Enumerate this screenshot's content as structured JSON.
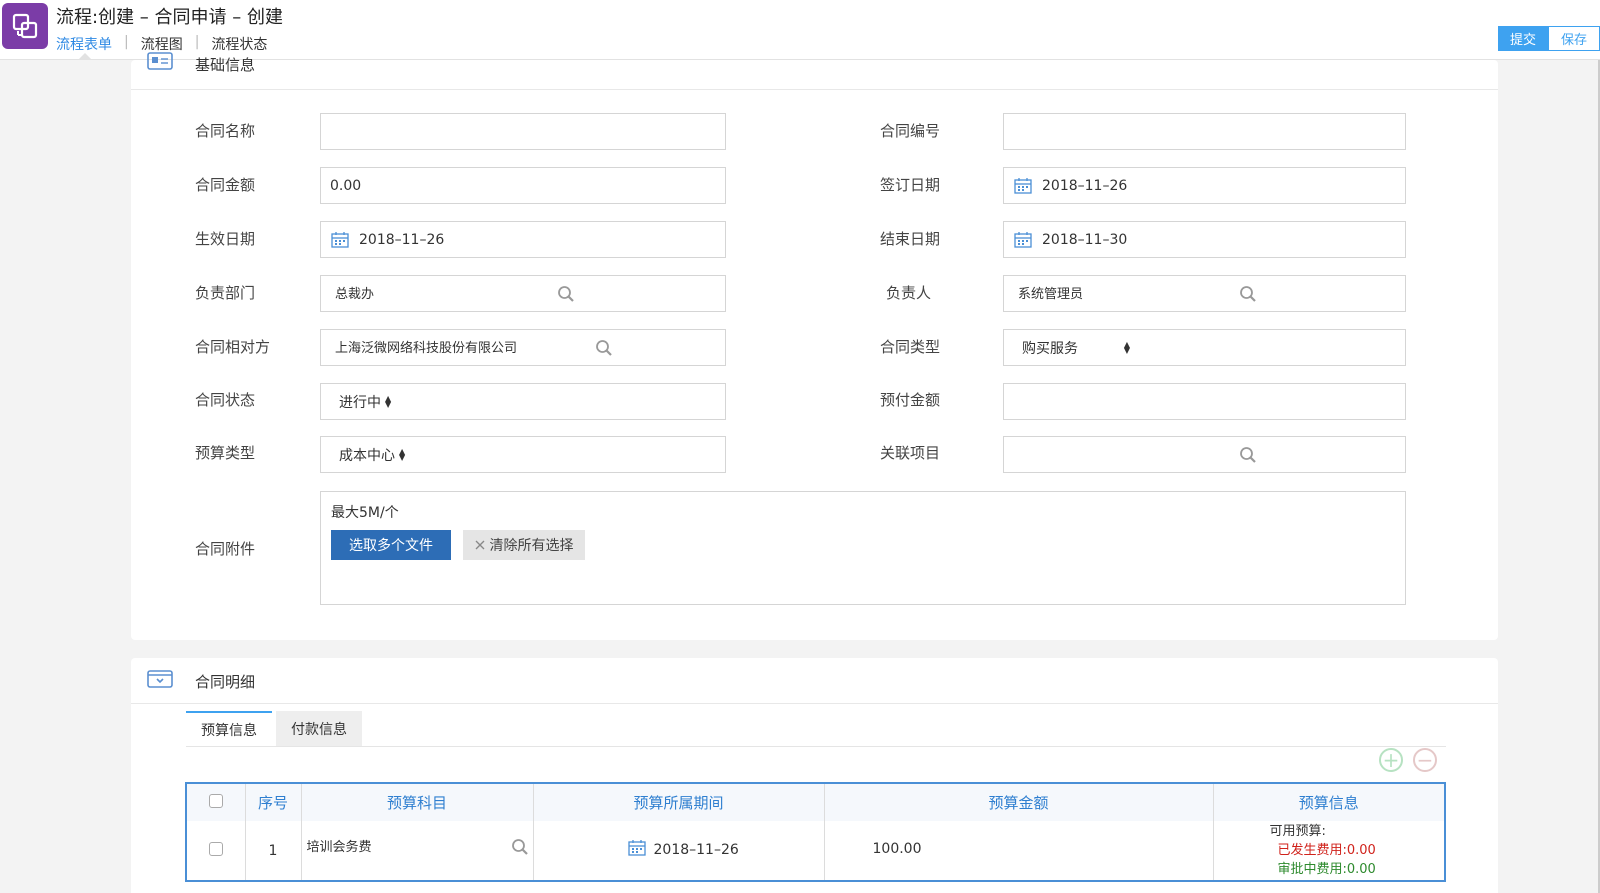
{
  "header": {
    "title": "流程:创建 – 合同申请 – 创建",
    "nav": [
      "流程表单",
      "流程图",
      "流程状态"
    ],
    "nav_sep": "|",
    "submit_label": "提交",
    "save_label": "保存"
  },
  "basic": {
    "section_title": "基础信息",
    "fields": {
      "contract_name": {
        "label": "合同名称",
        "value": ""
      },
      "contract_no": {
        "label": "合同编号",
        "value": ""
      },
      "contract_amount": {
        "label": "合同金额",
        "value": "0.00"
      },
      "sign_date": {
        "label": "签订日期",
        "value": "2018–11–26"
      },
      "effective_date": {
        "label": "生效日期",
        "value": "2018–11–26"
      },
      "end_date": {
        "label": "结束日期",
        "value": "2018–11–30"
      },
      "department": {
        "label": "负责部门",
        "value": "总裁办"
      },
      "owner": {
        "label": "负责人",
        "value": "系统管理员"
      },
      "counterparty": {
        "label": "合同相对方",
        "value": "上海泛微网络科技股份有限公司"
      },
      "contract_type": {
        "label": "合同类型",
        "value": "购买服务"
      },
      "contract_status": {
        "label": "合同状态",
        "value": "进行中"
      },
      "prepaid_amount": {
        "label": "预付金额",
        "value": ""
      },
      "budget_type": {
        "label": "预算类型",
        "value": "成本中心"
      },
      "related_project": {
        "label": "关联项目",
        "value": ""
      }
    },
    "attachment": {
      "label": "合同附件",
      "hint": "最大5M/个",
      "choose_label": "选取多个文件",
      "clear_label": "清除所有选择"
    }
  },
  "detail": {
    "section_title": "合同明细",
    "tabs": [
      "预算信息",
      "付款信息"
    ],
    "add_symbol": "+",
    "remove_symbol": "−",
    "columns": [
      "序号",
      "预算科目",
      "预算所属期间",
      "预算金额",
      "预算信息"
    ],
    "rows": [
      {
        "index": "1",
        "subject": "培训会务费",
        "period": "2018–11–26",
        "amount": "100.00",
        "available": "可用预算:",
        "incurred": "已发生费用:0.00",
        "approving": "审批中费用:0.00"
      }
    ]
  },
  "colors": {
    "accent": "#3ea2f0",
    "app_icon": "#7b3ca7",
    "primary_button": "#2d6db6",
    "table_border": "#4a8fd6",
    "incurred_text": "#d0221b",
    "approving_text": "#2d8a2d"
  },
  "icons": {
    "app": "workflow-app-icon",
    "calendar": "calendar-icon",
    "search": "search-icon",
    "clear": "close-icon",
    "section_basic": "id-card-icon",
    "section_detail": "tray-icon"
  }
}
